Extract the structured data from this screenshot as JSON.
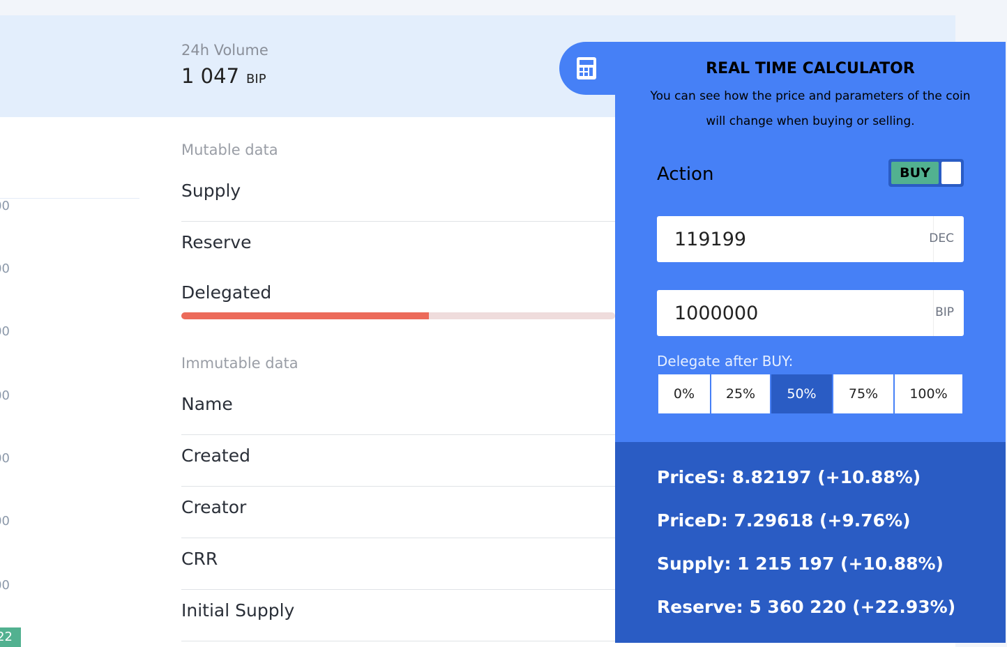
{
  "volume": {
    "label": "24h Volume",
    "value": "1 047",
    "unit": "BIP"
  },
  "axis_ticks": [
    "00",
    "00",
    "00",
    "00",
    "00",
    "00",
    "00"
  ],
  "badge": "22",
  "mutable": {
    "title": "Mutable data",
    "rows": [
      "Supply",
      "Reserve",
      "Delegated"
    ],
    "delegated_progress_pct": 57
  },
  "immutable": {
    "title": "Immutable data",
    "rows": [
      "Name",
      "Created",
      "Creator",
      "CRR",
      "Initial Supply"
    ]
  },
  "calculator": {
    "icon": "calculator-icon",
    "title": "REAL TIME CALCULATOR",
    "description": "You can see how the price and parameters of the coin will change when buying or selling.",
    "action_label": "Action",
    "toggle_label": "BUY",
    "amount1": {
      "value": "119199",
      "unit": "DEC"
    },
    "amount2": {
      "value": "1000000",
      "unit": "BIP"
    },
    "delegate_label": "Delegate after BUY:",
    "percent_options": [
      "0%",
      "25%",
      "50%",
      "75%",
      "100%"
    ],
    "selected_percent": "50%",
    "results": [
      "PriceS: 8.82197 (+10.88%)",
      "PriceD: 7.29618 (+9.76%)",
      "Supply: 1 215 197 (+10.88%)",
      "Reserve: 5 360 220 (+22.93%)"
    ]
  }
}
